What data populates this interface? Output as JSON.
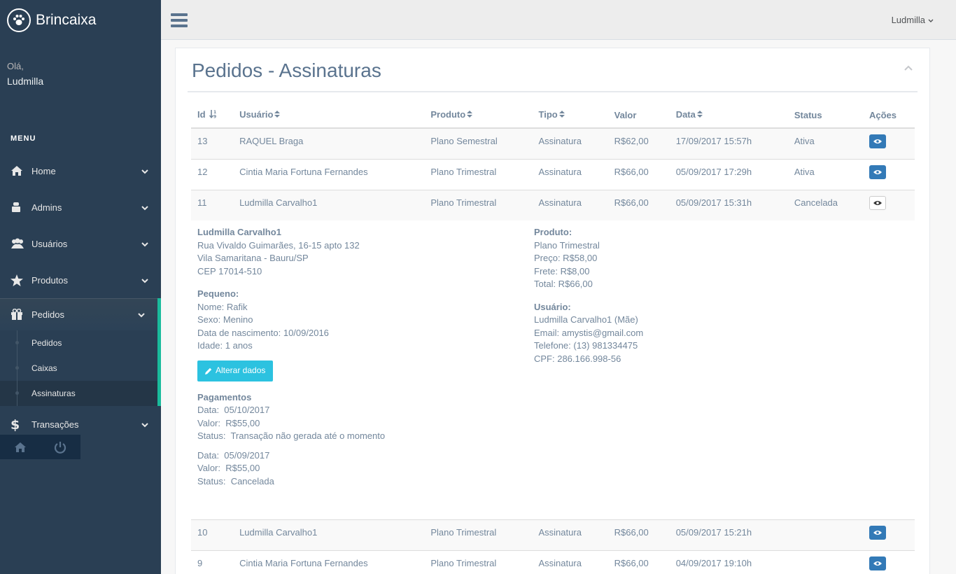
{
  "brand": {
    "name": "Brincaixa",
    "icon": "paw-icon"
  },
  "profile": {
    "greeting": "Olá,",
    "name": "Ludmilla"
  },
  "menu_title": "MENU",
  "nav": [
    {
      "label": "Home",
      "icon": "home-icon"
    },
    {
      "label": "Admins",
      "icon": "admin-icon"
    },
    {
      "label": "Usuários",
      "icon": "users-icon"
    },
    {
      "label": "Produtos",
      "icon": "star-icon"
    },
    {
      "label": "Pedidos",
      "icon": "gift-icon"
    },
    {
      "label": "Transações",
      "icon": "dollar-icon"
    }
  ],
  "submenu": [
    {
      "label": "Pedidos"
    },
    {
      "label": "Caixas"
    },
    {
      "label": "Assinaturas"
    }
  ],
  "topnav": {
    "user": "Ludmilla"
  },
  "page": {
    "title": "Pedidos - Assinaturas"
  },
  "table": {
    "headers": [
      "Id",
      "Usuário",
      "Produto",
      "Tipo",
      "Valor",
      "Data",
      "Status",
      "Ações"
    ],
    "rows": [
      {
        "id": "13",
        "usuario": "RAQUEL Braga",
        "produto": "Plano Semestral",
        "tipo": "Assinatura",
        "valor": "R$62,00",
        "data": "17/09/2017 15:57h",
        "status": "Ativa"
      },
      {
        "id": "12",
        "usuario": "Cintia Maria Fortuna Fernandes",
        "produto": "Plano Trimestral",
        "tipo": "Assinatura",
        "valor": "R$66,00",
        "data": "05/09/2017 17:29h",
        "status": "Ativa"
      },
      {
        "id": "11",
        "usuario": "Ludmilla Carvalho1",
        "produto": "Plano Trimestral",
        "tipo": "Assinatura",
        "valor": "R$66,00",
        "data": "05/09/2017 15:31h",
        "status": "Cancelada"
      },
      {
        "id": "10",
        "usuario": "Ludmilla Carvalho1",
        "produto": "Plano Trimestral",
        "tipo": "Assinatura",
        "valor": "R$66,00",
        "data": "05/09/2017 15:21h",
        "status": ""
      },
      {
        "id": "9",
        "usuario": "Cintia Maria Fortuna Fernandes",
        "produto": "Plano Trimestral",
        "tipo": "Assinatura",
        "valor": "R$66,00",
        "data": "04/09/2017 19:10h",
        "status": ""
      }
    ]
  },
  "details": {
    "name": "Ludmilla Carvalho1",
    "address1": "Rua Vivaldo Guimarães, 16-15 apto 132",
    "address2": "Vila Samaritana - Bauru/SP",
    "cep": "CEP 17014-510",
    "pequeno_title": "Pequeno:",
    "nome": "Nome: Rafik",
    "sexo": "Sexo: Menino",
    "nascimento": "Data de nascimento: 10/09/2016",
    "idade": "Idade: 1 anos",
    "edit_button": "Alterar dados",
    "pagamentos_title": "Pagamentos",
    "pag1_data": "Data:  05/10/2017",
    "pag1_valor": "Valor:  R$55,00",
    "pag1_status": "Status:  Transação não gerada até o momento",
    "pag2_data": "Data:  05/09/2017",
    "pag2_valor": "Valor:  R$55,00",
    "pag2_status": "Status:  Cancelada",
    "produto_title": "Produto:",
    "produto_nome": "Plano Trimestral",
    "preco": "Preço: R$58,00",
    "frete": "Frete: R$8,00",
    "total": "Total: R$66,00",
    "usuario_title": "Usuário:",
    "usuario_nome": "Ludmilla Carvalho1 (Mãe)",
    "email": "Email: amystis@gmail.com",
    "telefone": "Telefone: (13) 981334475",
    "cpf": "CPF: 286.166.998-56"
  },
  "colors": {
    "sidebar": "#2A3F54",
    "accent": "#1ABB9C",
    "primary": "#337AB7",
    "info": "#2CC2E0"
  }
}
